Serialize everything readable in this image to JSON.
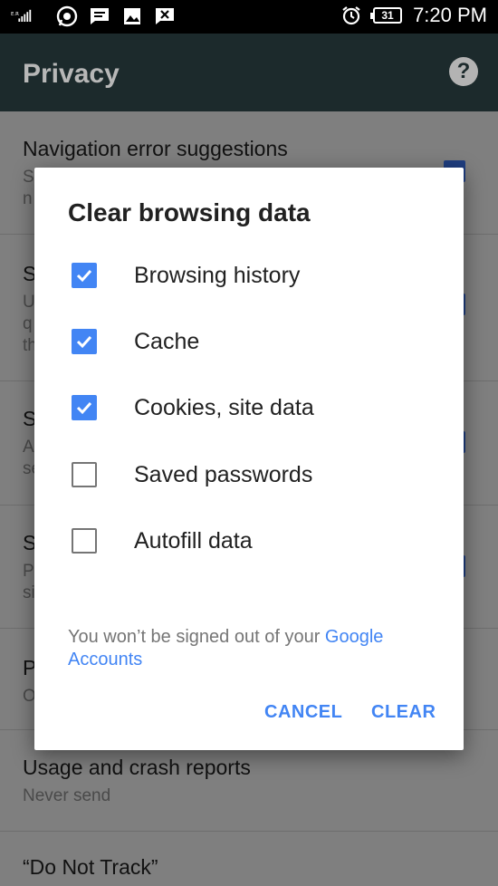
{
  "status_bar": {
    "network": "E.R",
    "battery": "31",
    "time": "7:20 PM",
    "icons": [
      "signal-icon",
      "whatsapp-icon",
      "message-icon",
      "gallery-icon",
      "missed-call-icon",
      "alarm-icon",
      "battery-icon"
    ]
  },
  "app_bar": {
    "title": "Privacy",
    "help_icon": "?"
  },
  "settings": [
    {
      "title": "Navigation error suggestions",
      "sub": "S\nn"
    },
    {
      "title": "S",
      "sub": "U\nq\nth"
    },
    {
      "title": "S",
      "sub": "A\nse"
    },
    {
      "title": "S",
      "sub": "P\nsi"
    },
    {
      "title": "P",
      "sub": "O"
    },
    {
      "title": "Usage and crash reports",
      "sub": "Never send"
    },
    {
      "title": "“Do Not Track”",
      "sub": ""
    }
  ],
  "dialog": {
    "title": "Clear browsing data",
    "options": [
      {
        "label": "Browsing history",
        "checked": true
      },
      {
        "label": "Cache",
        "checked": true
      },
      {
        "label": "Cookies, site data",
        "checked": true
      },
      {
        "label": "Saved passwords",
        "checked": false
      },
      {
        "label": "Autofill data",
        "checked": false
      }
    ],
    "note_text": "You won’t be signed out of your ",
    "note_link": "Google Accounts",
    "cancel_label": "CANCEL",
    "clear_label": "CLEAR"
  },
  "colors": {
    "accent": "#4285f4",
    "appbar": "#1c2a2c",
    "scrim": "#7f7f7f"
  }
}
